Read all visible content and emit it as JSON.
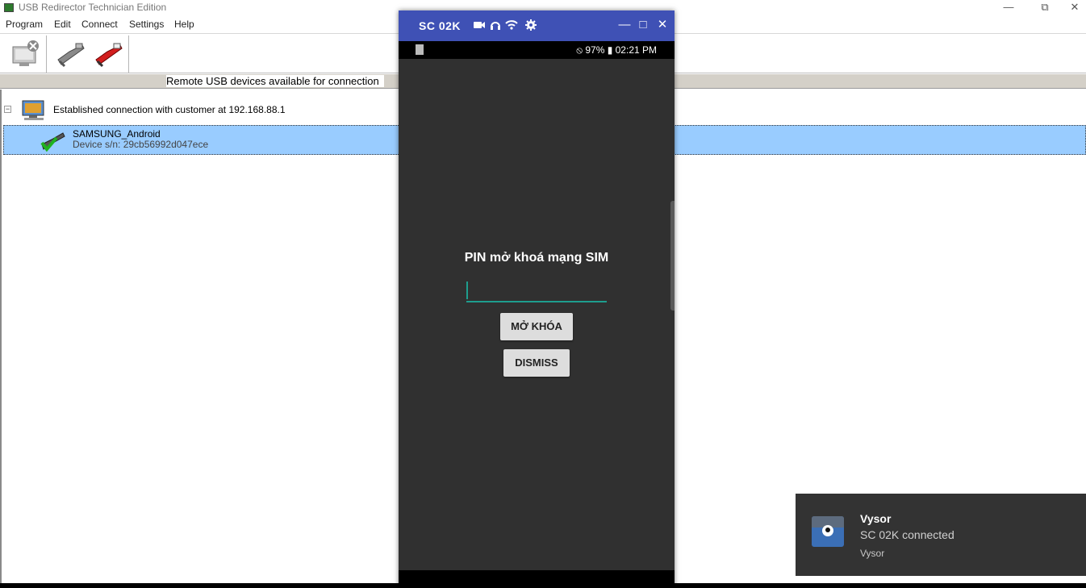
{
  "app": {
    "title": "USB Redirector Technician Edition",
    "window_controls": {
      "minimize": "—",
      "restore": "⧉",
      "close": "✕"
    }
  },
  "menu": [
    "Program",
    "Edit",
    "Connect",
    "Settings",
    "Help"
  ],
  "toolbar": {
    "buttons": [
      "remove-connection-icon",
      "connect-device-icon",
      "disconnect-device-icon"
    ]
  },
  "list": {
    "header": "Remote USB devices available for connection",
    "toggle": "−",
    "host_label": "Established connection with customer at 192.168.88.1",
    "device": {
      "name": "SAMSUNG_Android",
      "serial": "Device s/n: 29cb56992d047ece"
    }
  },
  "vysor": {
    "device_name": "SC 02K",
    "title_icons": [
      "video-camera-icon",
      "headphones-icon",
      "wifi-icon",
      "settings-gear-icon"
    ],
    "controls": {
      "minimize": "—",
      "maximize": "□",
      "close": "✕"
    },
    "status": {
      "right": "⦸ 97% ▮ 02:21 PM"
    },
    "dialog": {
      "title": "PIN mở khoá mạng SIM",
      "input_value": "",
      "unlock_label": "MỞ KHÓA",
      "dismiss_label": "DISMISS"
    }
  },
  "toast": {
    "title": "Vysor",
    "message": "SC 02K connected",
    "source": "Vysor"
  },
  "colors": {
    "selection": "#99ccff",
    "vysor_titlebar": "#3f51b5",
    "phone_bg": "#303030",
    "input_accent": "#1e9e8e",
    "toast_bg": "#333333"
  }
}
